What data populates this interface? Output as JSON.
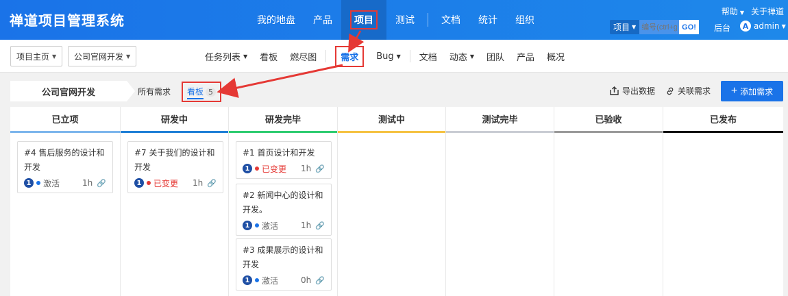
{
  "app": {
    "title": "禅道项目管理系统"
  },
  "mainnav": [
    "我的地盘",
    "产品",
    "项目",
    "测试",
    "文档",
    "统计",
    "组织"
  ],
  "topright": {
    "help": "帮助",
    "about": "关于禅道"
  },
  "search": {
    "type": "项目",
    "placeholder": "编号(ctrl+g)",
    "go": "GO!"
  },
  "backend": "后台",
  "user": {
    "avatar": "A",
    "name": "admin"
  },
  "breadcrumb": {
    "home": "项目主页",
    "project": "公司官网开发"
  },
  "subnav": [
    "任务列表",
    "看板",
    "燃尽图",
    "需求",
    "Bug",
    "文档",
    "动态",
    "团队",
    "产品",
    "概况"
  ],
  "toolbar": {
    "project": "公司官网开发",
    "tab_all": "所有需求",
    "tab_board": "看板",
    "board_count": "5",
    "export": "导出数据",
    "link": "关联需求",
    "add": "添加需求"
  },
  "columns": [
    {
      "name": "已立项",
      "color": "#7cb5ec"
    },
    {
      "name": "研发中",
      "color": "#1f7fd6"
    },
    {
      "name": "研发完毕",
      "color": "#2ecc71"
    },
    {
      "name": "测试中",
      "color": "#f5c242"
    },
    {
      "name": "测试完毕",
      "color": "#c9ccd3"
    },
    {
      "name": "已验收",
      "color": "#999999"
    },
    {
      "name": "已发布",
      "color": "#111111"
    }
  ],
  "cards": {
    "c1": {
      "title": "#4 售后服务的设计和开发",
      "pri": "1",
      "status": "激活",
      "est": "1h"
    },
    "c2": {
      "title": "#7 关于我们的设计和开发",
      "pri": "1",
      "status": "已变更",
      "est": "1h"
    },
    "c3": {
      "title": "#1 首页设计和开发",
      "pri": "1",
      "status": "已变更",
      "est": "1h"
    },
    "c4": {
      "title": "#2 新闻中心的设计和开发。",
      "pri": "1",
      "status": "激活",
      "est": "1h"
    },
    "c5": {
      "title": "#3 成果展示的设计和开发",
      "pri": "1",
      "status": "激活",
      "est": "0h"
    }
  },
  "colors": {
    "primary": "#1a73e8",
    "active": "#1a73e8",
    "changed": "#e53935",
    "highlight": "#e53935"
  },
  "icons": [
    "caret-down-icon",
    "export-icon",
    "link-icon",
    "plus-icon",
    "chain-link-icon"
  ]
}
